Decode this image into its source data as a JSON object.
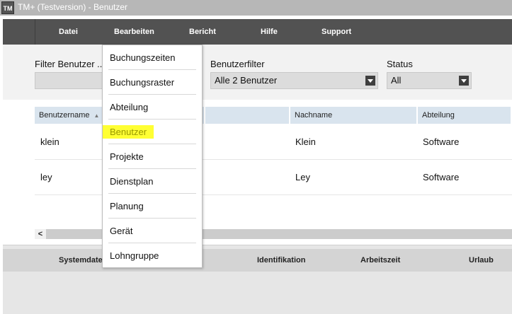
{
  "window": {
    "icon_text": "TM",
    "title": "TM+ (Testversion) - Benutzer"
  },
  "menubar": {
    "items": [
      {
        "label": "Datei"
      },
      {
        "label": "Bearbeiten"
      },
      {
        "label": "Bericht"
      },
      {
        "label": "Hilfe"
      },
      {
        "label": "Support"
      }
    ]
  },
  "filters": {
    "benutzer_label": "Filter Benutzer ...",
    "benutzer_value": "",
    "benutzerfilter_label": "Benutzerfilter",
    "benutzerfilter_value": "Alle 2 Benutzer",
    "status_label": "Status",
    "status_value": "All"
  },
  "table": {
    "columns": [
      {
        "label": "Benutzername"
      },
      {
        "label": "Nachname"
      },
      {
        "label": "Abteilung"
      }
    ],
    "rows": [
      {
        "benutzername": "klein",
        "nachname": "Klein",
        "abteilung": "Software"
      },
      {
        "benutzername": "ley",
        "nachname": "Ley",
        "abteilung": "Software"
      }
    ]
  },
  "bottom_panel": {
    "headers": [
      {
        "label": "Systemdaten"
      },
      {
        "label": "Identifikation"
      },
      {
        "label": "Arbeitszeit"
      },
      {
        "label": "Urlaub"
      }
    ]
  },
  "dropdown": {
    "items": [
      {
        "label": "Buchungszeiten"
      },
      {
        "label": "Buchungsraster"
      },
      {
        "label": "Abteilung"
      },
      {
        "label": "Benutzer",
        "highlighted": true
      },
      {
        "label": "Projekte"
      },
      {
        "label": "Dienstplan"
      },
      {
        "label": "Planung"
      },
      {
        "label": "Gerät"
      },
      {
        "label": "Lohngruppe"
      }
    ]
  },
  "colors": {
    "menubar_bg": "#525252",
    "highlight": "#ffff33",
    "table_header_bg": "#d9e4ee"
  }
}
